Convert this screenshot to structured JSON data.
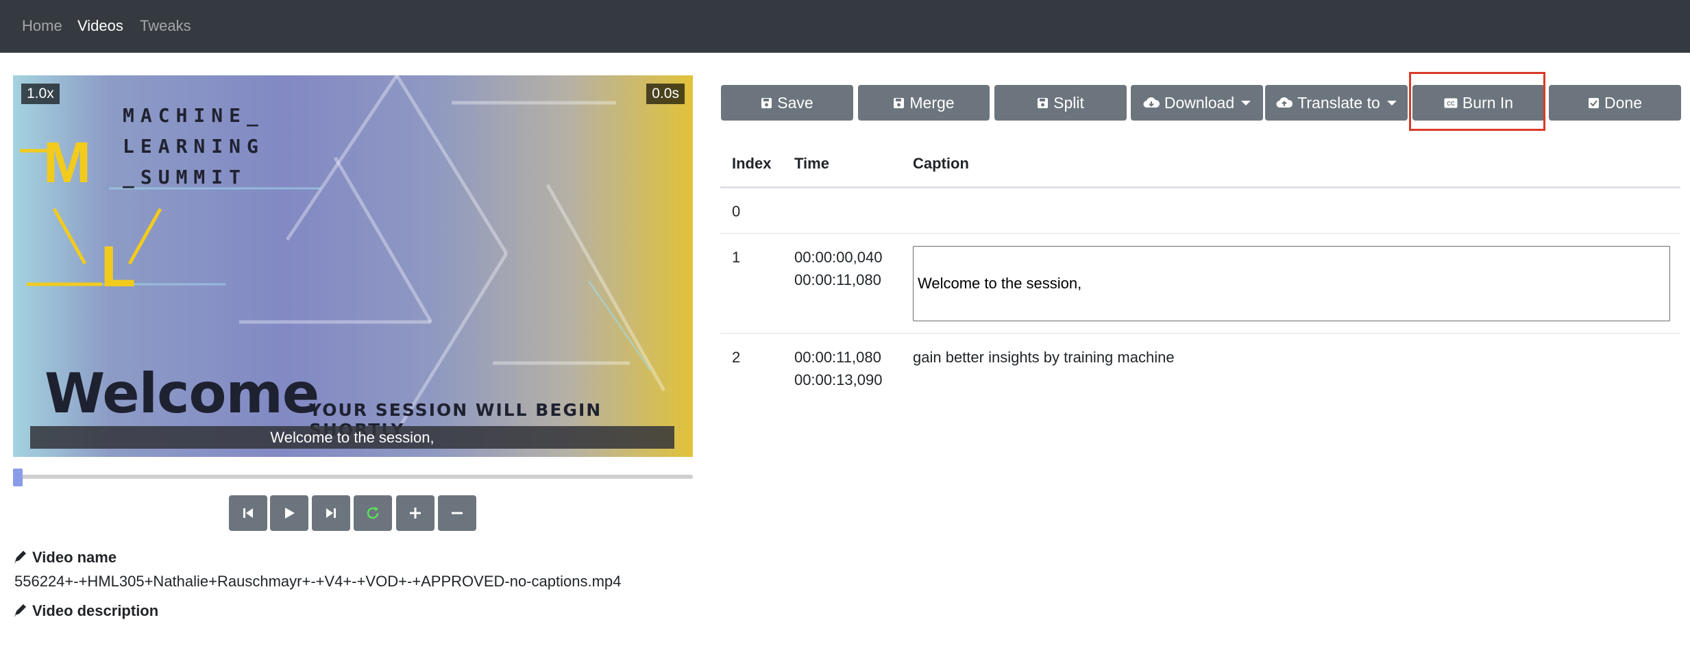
{
  "nav": {
    "items": [
      {
        "label": "Home",
        "active": false
      },
      {
        "label": "Videos",
        "active": true
      },
      {
        "label": "Tweaks",
        "active": false
      }
    ]
  },
  "player": {
    "speed": "1.0x",
    "time": "0.0s",
    "frame": {
      "logo_lines": [
        "MACHINE_",
        "LEARNING",
        "_SUMMIT"
      ],
      "logo_m": "M",
      "logo_l": "L",
      "headline": "Welcome",
      "tagline": "YOUR SESSION WILL BEGIN SHORTLY"
    },
    "subtitle": "Welcome to the session,",
    "progress_fraction": 0,
    "controls": [
      "skip-back-icon",
      "play-icon",
      "skip-forward-icon",
      "reload-icon",
      "plus-icon",
      "minus-icon"
    ]
  },
  "video_info": {
    "name_label": "Video name",
    "name_value": "556224+-+HML305+Nathalie+Rauschmayr+-+V4+-+VOD+-+APPROVED-no-captions.mp4",
    "description_label": "Video description"
  },
  "toolbar": {
    "save": "Save",
    "merge": "Merge",
    "split": "Split",
    "download": "Download",
    "translate": "Translate to",
    "burn_in": "Burn In",
    "done": "Done"
  },
  "table": {
    "headers": [
      "Index",
      "Time",
      "Caption"
    ],
    "rows": [
      {
        "index": "0",
        "start": "",
        "end": "",
        "caption": ""
      },
      {
        "index": "1",
        "start": "00:00:00,040",
        "end": "00:00:11,080",
        "caption": "Welcome to the session,"
      },
      {
        "index": "2",
        "start": "00:00:11,080",
        "end": "00:00:13,090",
        "caption": "gain better insights by training machine"
      }
    ]
  },
  "colors": {
    "navbar": "#343a40",
    "button": "#6c757d",
    "highlight": "#d93a25",
    "accent_yellow": "#f2cb1d",
    "progress_thumb": "#8a9be8"
  }
}
